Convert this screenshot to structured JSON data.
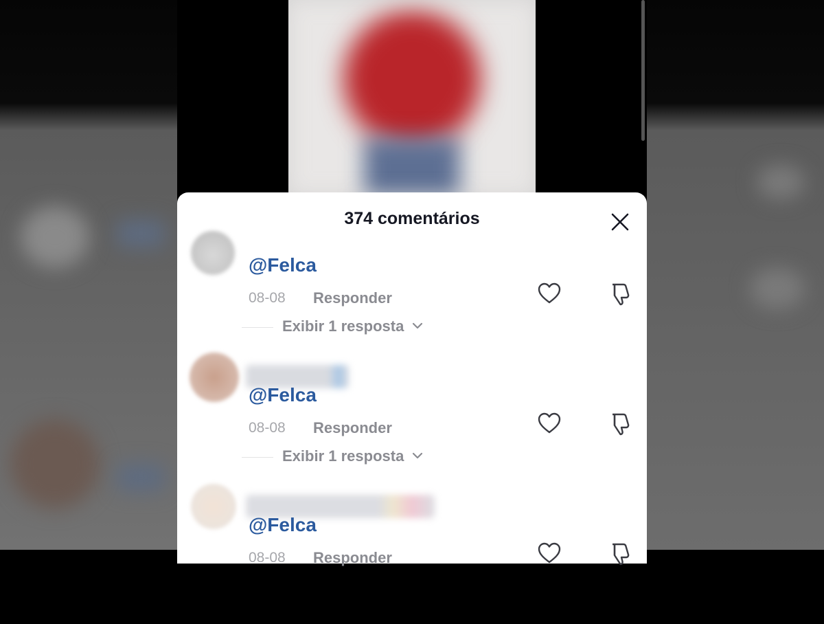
{
  "sheet": {
    "title": "374 comentários"
  },
  "comments": [
    {
      "mention": "@Felca",
      "date": "08-08",
      "reply_label": "Responder",
      "show_replies_label": "Exibir 1 resposta"
    },
    {
      "mention": "@Felca",
      "date": "08-08",
      "reply_label": "Responder",
      "show_replies_label": "Exibir 1 resposta"
    },
    {
      "mention": "@Felca",
      "date": "08-08",
      "reply_label": "Responder"
    }
  ],
  "icons": {
    "close": "close-icon",
    "like": "heart-icon",
    "dislike": "thumbs-down-icon",
    "chevron": "chevron-down-icon"
  },
  "colors": {
    "mention": "#2b5a9e",
    "muted": "#8a8b91",
    "date": "#a6a7ab",
    "title": "#161823"
  }
}
